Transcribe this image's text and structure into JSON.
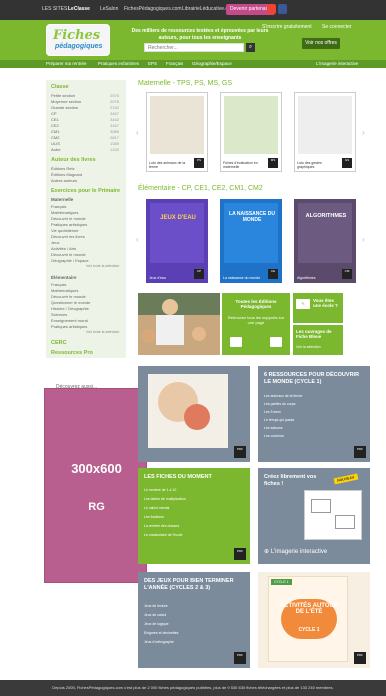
{
  "topbar": {
    "links": [
      "LES SITES",
      "LeClasse",
      "LeSalon",
      "FichesPédagogiques.com",
      "LibrairieLéducative.com"
    ],
    "partner_button": "Devenir partenaire",
    "newsletter": "S'inscrire gratuitement",
    "account": "Se connecter"
  },
  "header": {
    "logo_line1": "Fiches",
    "logo_line2": "pédagogiques",
    "tagline": "Des milliers de ressources testées et éprouvées par leurs auteurs, pour tous les enseignants",
    "search_placeholder": "Rechercher...",
    "newsletter_button": "Voir nos offres"
  },
  "nav": {
    "items": [
      "Préparer ma rentrée",
      "Pratiques enfantines",
      "EPS",
      "Français",
      "Géographie/Espace"
    ],
    "imagerie": "L'imagerie interactive"
  },
  "sidebar": {
    "classes_title": "Classe",
    "classes": [
      {
        "label": "Petite section",
        "count": "2070"
      },
      {
        "label": "Moyenne section",
        "count": "2078"
      },
      {
        "label": "Grande section",
        "count": "2152"
      },
      {
        "label": "CP",
        "count": "3457"
      },
      {
        "label": "CE1",
        "count": "3442"
      },
      {
        "label": "CE2",
        "count": "3167"
      },
      {
        "label": "CM1",
        "count": "3089"
      },
      {
        "label": "CM2",
        "count": "2817"
      },
      {
        "label": "ULIS",
        "count": "1085"
      },
      {
        "label": "Autre",
        "count": "1432"
      }
    ],
    "authors_title": "Auteur des livres",
    "authors": [
      "Éditions Retz",
      "Éditions Magnard",
      "Autres auteurs"
    ],
    "exercices_title": "Exercices pour le Primaire",
    "maternelle_sub": "Maternelle",
    "maternelle_items": [
      "Français",
      "Mathématiques",
      "Découvrir le monde",
      "Pratiques artistiques",
      "Vie quotidienne",
      "Découvrir les livres",
      "Jeux",
      "Activités / Arts",
      "Découvrir le monde",
      "Géographie / Espace"
    ],
    "elementaire_sub": "Élémentaire",
    "elementaire_items": [
      "Français",
      "Mathématiques",
      "Découvrir le monde",
      "Questionner le monde",
      "Histoire / Géographie",
      "Sciences",
      "Enseignement moral",
      "Pratiques artistiques"
    ],
    "more": "Voir toute la sélection",
    "cerc": "CERC",
    "pro": "Ressources Pro"
  },
  "sections": {
    "maternelle_title": "Maternelle - TPS, PS, MS, GS",
    "elementaire_title": "Élémentaire - CP, CE1, CE2, CM1, CM2"
  },
  "books_mat": [
    {
      "caption": "Loto des animaux de la ferme"
    },
    {
      "caption": "Fiches d'évaluation en maternelle"
    },
    {
      "caption": "Loto des gestes graphiques"
    }
  ],
  "books_elem": [
    {
      "caption": "Jeux d'eau",
      "cover": "JEUX D'EAU"
    },
    {
      "caption": "La naissance du monde",
      "cover": "LA NAISSANCE DU MONDE"
    },
    {
      "caption": "Algorithmes",
      "cover": "ALGORITHMES"
    }
  ],
  "promo": {
    "center_title": "Toutes les Éditions Pédagogiques",
    "center_text": "Retrouvez tous les supports sur une page",
    "box1_title": "Vous êtes une école ?",
    "box2_title": "Les ouvrages de Fiche Bleue",
    "box2_link": "Voir la sélection"
  },
  "ad": {
    "label": "Découvrez aussi...",
    "size": "300x600",
    "type": "RG"
  },
  "cards": {
    "c1_title": "",
    "c2_title": "6 RESSOURCES POUR DÉCOUVRIR LE MONDE (CYCLE 1)",
    "c2_lines": [
      "Les animaux de la ferme",
      "Les parties du corps",
      "Les 5 sens",
      "Le temps qui passe",
      "Les saisons",
      "Les couleurs"
    ],
    "c3_title": "LES FICHES DU MOMENT",
    "c3_lines": [
      "Le nombre de 1 à 10",
      "Les tables de multiplication",
      "Le calcul mental",
      "Les fractions",
      "La rentrée des classes",
      "Le vocabulaire de l'école"
    ],
    "c4_title": "Créez librement vos fiches !",
    "c4_badge": "NOUVEAU",
    "c4_footer": "L'imagerie interactive",
    "c5_title": "DES JEUX POUR BIEN TERMINER L'ANNÉE (CYCLES 2 & 3)",
    "c5_lines": [
      "Jeux de lecture",
      "Jeux de calcul",
      "Jeux de logique",
      "Énigmes et devinettes",
      "Jeux d'orthographe"
    ],
    "c6_title": "ACTIVITÉS AUTOUR DE L'ÉTÉ",
    "c6_sub": "CYCLE 1",
    "c6_badge": "CYCLE 1"
  },
  "footer": {
    "text": "Depuis 2005, FichesPédagogiques.com c'est plus de 2 000 fiches pédagogiques publiées, plus de 9 530 630 fiches téléchargées et plus de 133 240 membres."
  },
  "colors": {
    "accent": "#7cb82f",
    "dark": "#333333",
    "grey_card": "#7c8b9c",
    "ad": "#b85f8f"
  }
}
